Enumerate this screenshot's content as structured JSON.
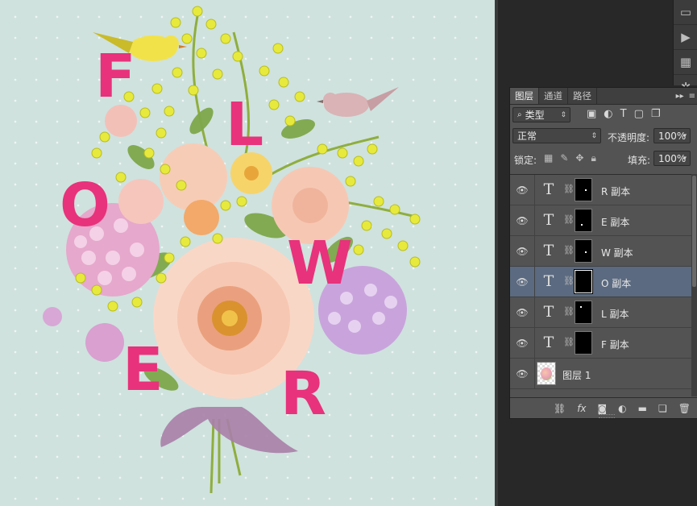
{
  "canvas": {
    "letters": [
      "F",
      "L",
      "O",
      "W",
      "E",
      "R"
    ]
  },
  "toolstrip": {
    "icons": [
      "panel-icon",
      "play-icon",
      "grid-icon",
      "brush-settings-icon"
    ]
  },
  "layers_panel": {
    "tabs": [
      "图层",
      "通道",
      "路径"
    ],
    "active_tab": "图层",
    "filter": {
      "label": "类型"
    },
    "blend_mode": "正常",
    "opacity_label": "不透明度:",
    "opacity_value": "100%",
    "lock_label": "锁定:",
    "fill_label": "填充:",
    "fill_value": "100%",
    "layers": [
      {
        "name": "R 副本",
        "type": "text",
        "selected": false
      },
      {
        "name": "E 副本",
        "type": "text",
        "selected": false
      },
      {
        "name": "W 副本",
        "type": "text",
        "selected": false
      },
      {
        "name": "O 副本",
        "type": "text",
        "selected": true
      },
      {
        "name": "L  副本",
        "type": "text",
        "selected": false
      },
      {
        "name": "F 副本",
        "type": "text",
        "selected": false
      },
      {
        "name": "图层 1",
        "type": "image",
        "selected": false
      }
    ],
    "footer_icons": [
      "link-layers-icon",
      "fx-icon",
      "add-mask-icon",
      "adjustment-layer-icon",
      "new-group-icon",
      "new-layer-icon",
      "delete-layer-icon"
    ],
    "footer_fx": "fx",
    "text_glyph": "T",
    "colors": {
      "selected_row": "#5b6a80",
      "letter_color": "#e8327b",
      "canvas_bg": "#cfe2de"
    }
  }
}
